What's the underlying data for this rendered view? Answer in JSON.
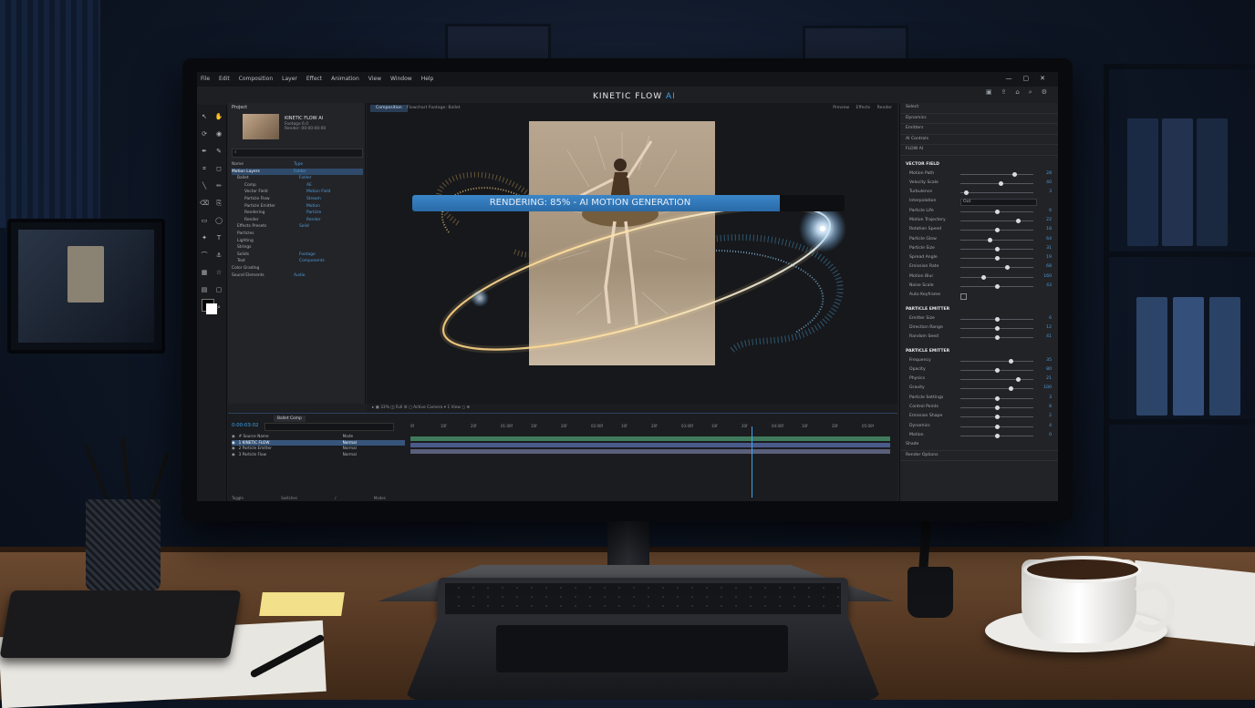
{
  "app": {
    "title_main": "KINETIC FLOW",
    "title_ai": "AI",
    "menu": [
      "File",
      "Edit",
      "Composition",
      "Layer",
      "Effect",
      "Animation",
      "View",
      "Window",
      "Help"
    ]
  },
  "project": {
    "panel_label": "Project",
    "name": "KINETIC FLOW AI",
    "sub1": "Footage 6.0",
    "sub2": "Render: 00:00:00:00",
    "search_placeholder": "⌕",
    "tree": [
      {
        "name": "Name",
        "type": "Type",
        "sel": false,
        "indent": 0
      },
      {
        "name": "Motion Layers",
        "type": "Folder",
        "sel": true,
        "indent": 0
      },
      {
        "name": "Ballet",
        "type": "Folder",
        "sel": false,
        "indent": 1
      },
      {
        "name": "Comp",
        "type": "AE",
        "sel": false,
        "indent": 2
      },
      {
        "name": "Vector Field",
        "type": "Motion Field",
        "sel": false,
        "indent": 2
      },
      {
        "name": "Particle Flow",
        "type": "Stream",
        "sel": false,
        "indent": 2
      },
      {
        "name": "Particle Emitter",
        "type": "Motion",
        "sel": false,
        "indent": 2
      },
      {
        "name": "Rendering",
        "type": "Particle",
        "sel": false,
        "indent": 2
      },
      {
        "name": "Render",
        "type": "Render",
        "sel": false,
        "indent": 2
      },
      {
        "name": "Effects Presets",
        "type": "Solid",
        "sel": false,
        "indent": 1
      },
      {
        "name": "Particles",
        "type": "",
        "sel": false,
        "indent": 1
      },
      {
        "name": "Lighting",
        "type": "",
        "sel": false,
        "indent": 1
      },
      {
        "name": "Strings",
        "type": "",
        "sel": false,
        "indent": 1
      },
      {
        "name": "Solids",
        "type": "Footage",
        "sel": false,
        "indent": 1
      },
      {
        "name": "Text",
        "type": "Components",
        "sel": false,
        "indent": 1
      },
      {
        "name": "Color Grading",
        "type": "",
        "sel": false,
        "indent": 0
      },
      {
        "name": "Sound Elements",
        "type": "Audio",
        "sel": false,
        "indent": 0
      }
    ]
  },
  "composition": {
    "tab_active": "Composition",
    "tabs_rest": "Flowchart   Footage: Ballet",
    "right_labels": "Preview  Effects  Render",
    "footer": "▸  ▣  33%  ◫  Full  ⚙  ◻  Active Camera  ▾  1 View  ◻  ⊕"
  },
  "properties": {
    "top_sections": [
      "Select",
      "Dynamics",
      "Emitters",
      "AI Controls",
      "FLOW AI"
    ],
    "vector_field": {
      "title": "VECTOR FIELD",
      "rows": [
        {
          "label": "Motion Path",
          "value": 0.75,
          "num": "28"
        },
        {
          "label": "Velocity Scale",
          "value": 0.55,
          "num": "40"
        },
        {
          "label": "Turbulence",
          "value": 0.05,
          "num": "3"
        },
        {
          "label": "Interpolation",
          "dropdown": "Out"
        },
        {
          "label": "Particle Life",
          "value": 0.5,
          "num": "6"
        },
        {
          "label": "Motion Trajectory",
          "value": 0.8,
          "num": "22"
        },
        {
          "label": "Rotation Speed",
          "value": 0.5,
          "num": "18"
        },
        {
          "label": "Particle Glow",
          "value": 0.4,
          "num": "64"
        },
        {
          "label": "Particle Size",
          "value": 0.5,
          "num": "31"
        },
        {
          "label": "Spread Angle",
          "value": 0.5,
          "num": "19"
        },
        {
          "label": "Emission Rate",
          "value": 0.65,
          "num": "68"
        },
        {
          "label": "Motion Blur",
          "value": 0.3,
          "num": "160"
        },
        {
          "label": "Noise Scale",
          "value": 0.5,
          "num": "43"
        },
        {
          "label": "Auto Keyframe",
          "checkbox": true
        }
      ]
    },
    "particle_emitter_1": {
      "title": "PARTICLE EMITTER",
      "rows": [
        {
          "label": "Emitter Size",
          "value": 0.5,
          "num": "6"
        },
        {
          "label": "Direction Range",
          "value": 0.5,
          "num": "12"
        },
        {
          "label": "Random Seed",
          "value": 0.5,
          "num": "41"
        }
      ]
    },
    "particle_emitter_2": {
      "title": "PARTICLE EMITTER",
      "rows": [
        {
          "label": "Frequency",
          "value": 0.7,
          "num": "35"
        },
        {
          "label": "Opacity",
          "value": 0.5,
          "num": "80"
        },
        {
          "label": "Physics",
          "value": 0.8,
          "num": "21"
        },
        {
          "label": "Gravity",
          "value": 0.7,
          "num": "100"
        },
        {
          "label": "Particle Settings",
          "value": 0.5,
          "num": "3"
        },
        {
          "label": "Control Points",
          "value": 0.5,
          "num": "8"
        },
        {
          "label": "Emission Shape",
          "value": 0.5,
          "num": "2"
        },
        {
          "label": "Dynamics",
          "value": 0.5,
          "num": "4"
        },
        {
          "label": "Motion",
          "value": 0.5,
          "num": "0"
        }
      ]
    },
    "bottom_sections": [
      "Shade",
      "Render Options"
    ]
  },
  "timeline": {
    "tab": "Ballet Comp",
    "timecode": "0:00:03:02",
    "ruler": [
      "0f",
      "10f",
      "20f",
      "01:00f",
      "10f",
      "20f",
      "02:00f",
      "10f",
      "20f",
      "03:00f",
      "10f",
      "20f",
      "04:00f",
      "10f",
      "20f",
      "05:00f"
    ],
    "layers": [
      {
        "name": "# Source Name",
        "mode": "Mode",
        "sel": false
      },
      {
        "name": "1  KINETIC FLOW",
        "mode": "Normal",
        "sel": true
      },
      {
        "name": "2  Particle Emitter",
        "mode": "Normal",
        "sel": false
      },
      {
        "name": "3  Particle Flow",
        "mode": "Normal",
        "sel": false
      }
    ],
    "render_progress": 0.85,
    "render_text": "RENDERING: 85% - AI MOTION GENERATION",
    "footer": "Toggle Switches / Modes"
  },
  "colors": {
    "accent": "#3aa3f0",
    "gold": "#f6c86a",
    "cyan": "#4fb6f0"
  }
}
